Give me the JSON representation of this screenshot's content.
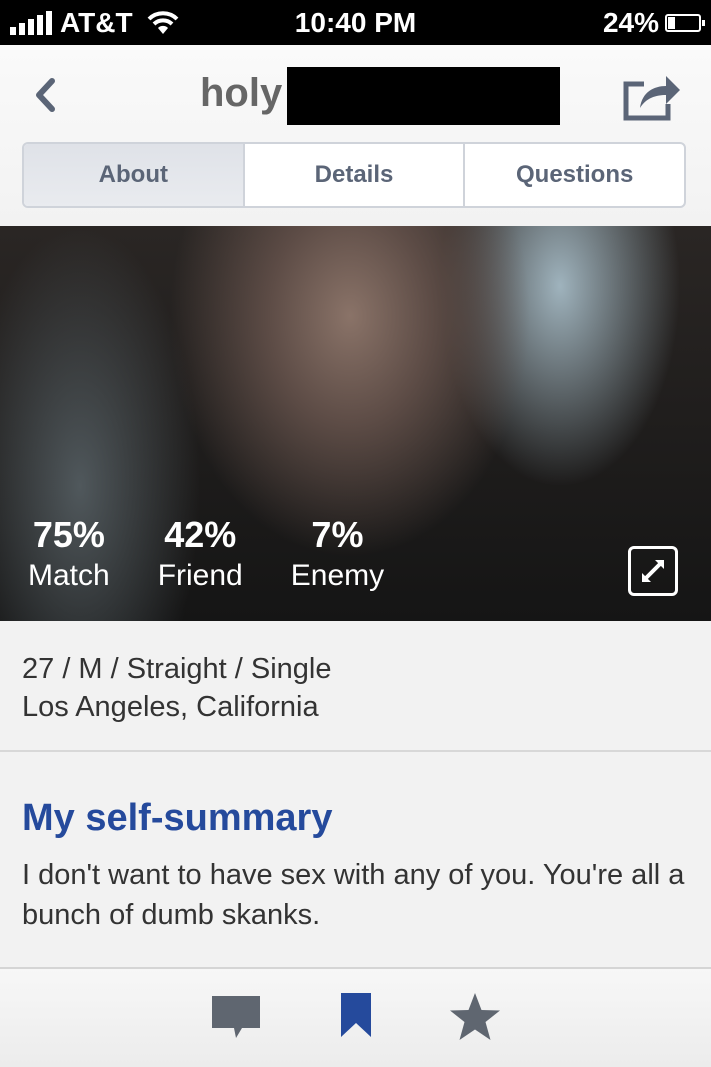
{
  "status_bar": {
    "carrier": "AT&T",
    "time": "10:40 PM",
    "battery": "24%",
    "battery_level": 0.24
  },
  "header": {
    "title": "holy",
    "back_icon": "chevron-left-icon",
    "share_icon": "share-icon"
  },
  "tabs": [
    {
      "label": "About",
      "active": true
    },
    {
      "label": "Details",
      "active": false
    },
    {
      "label": "Questions",
      "active": false
    }
  ],
  "photo": {
    "stats": [
      {
        "value": "75%",
        "label": "Match"
      },
      {
        "value": "42%",
        "label": "Friend"
      },
      {
        "value": "7%",
        "label": "Enemy"
      }
    ],
    "expand_icon": "expand-icon"
  },
  "profile": {
    "basics": "27 / M / Straight / Single",
    "location": "Los Angeles, California"
  },
  "summary": {
    "heading": "My self-summary",
    "text": "I don't want to have sex with any of you. You're all a bunch of dumb skanks."
  },
  "bottom_bar": {
    "icons": [
      "message-icon",
      "bookmark-icon",
      "star-icon"
    ],
    "accent_color": "#254a9c",
    "icon_color": "#5f6670"
  }
}
